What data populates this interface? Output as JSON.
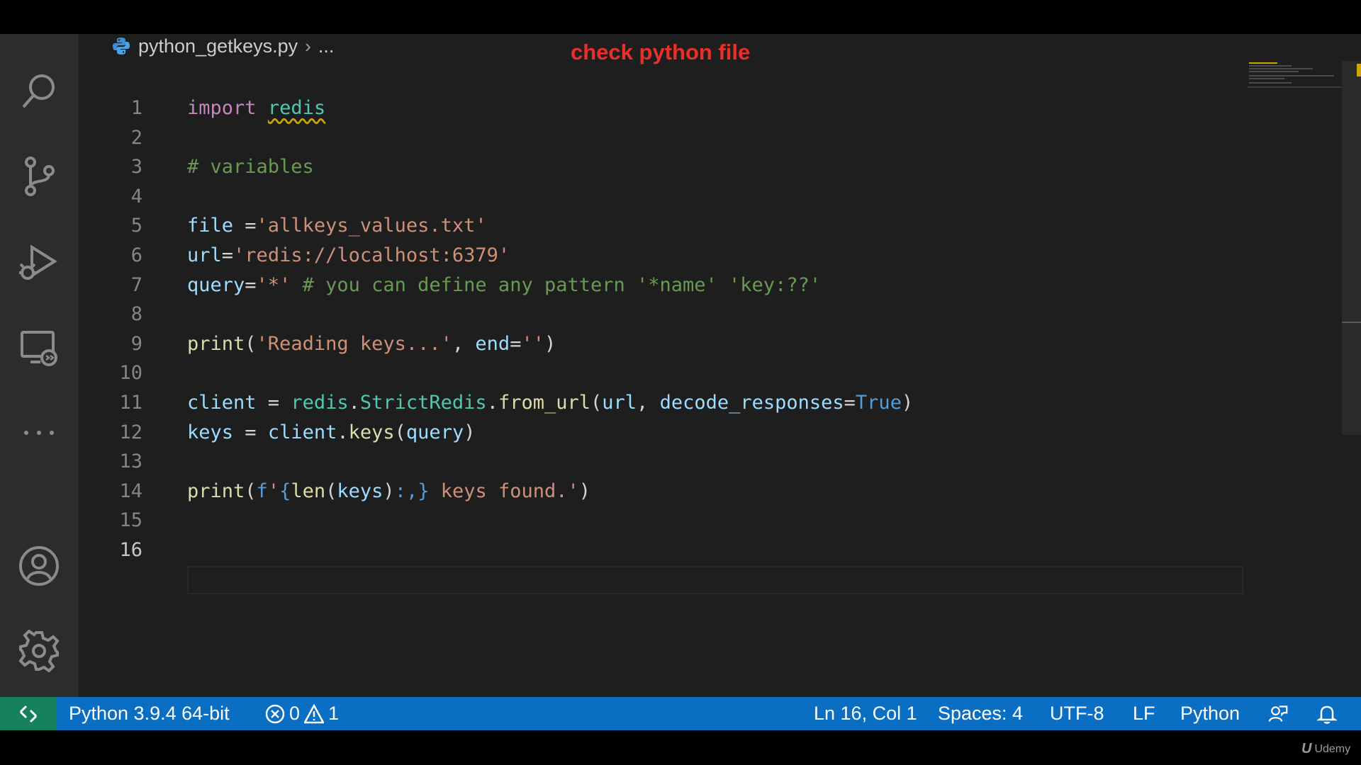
{
  "editor": {
    "breadcrumb": {
      "file": "python_getkeys.py",
      "more": "..."
    },
    "annotation": "check python file",
    "lines": [
      {
        "n": "1",
        "tokens": [
          [
            "kw",
            "import"
          ],
          [
            "op",
            " "
          ],
          [
            "mod squig",
            "redis"
          ]
        ]
      },
      {
        "n": "2",
        "tokens": []
      },
      {
        "n": "3",
        "tokens": [
          [
            "cm",
            "# variables"
          ]
        ]
      },
      {
        "n": "4",
        "tokens": []
      },
      {
        "n": "5",
        "tokens": [
          [
            "var",
            "file"
          ],
          [
            "op",
            " ="
          ],
          [
            "str",
            "'allkeys_values.txt'"
          ]
        ]
      },
      {
        "n": "6",
        "tokens": [
          [
            "var",
            "url"
          ],
          [
            "op",
            "="
          ],
          [
            "str",
            "'redis://localhost:6379'"
          ]
        ]
      },
      {
        "n": "7",
        "tokens": [
          [
            "var",
            "query"
          ],
          [
            "op",
            "="
          ],
          [
            "str",
            "'*'"
          ],
          [
            "op",
            " "
          ],
          [
            "cm",
            "# you can define any pattern '*name' 'key:??'"
          ]
        ]
      },
      {
        "n": "8",
        "tokens": []
      },
      {
        "n": "9",
        "tokens": [
          [
            "fn",
            "print"
          ],
          [
            "op",
            "("
          ],
          [
            "str",
            "'Reading keys...'"
          ],
          [
            "op",
            ", "
          ],
          [
            "var",
            "end"
          ],
          [
            "op",
            "="
          ],
          [
            "str",
            "''"
          ],
          [
            "op",
            ")"
          ]
        ]
      },
      {
        "n": "10",
        "tokens": []
      },
      {
        "n": "11",
        "tokens": [
          [
            "var",
            "client"
          ],
          [
            "op",
            " = "
          ],
          [
            "cls",
            "redis"
          ],
          [
            "op",
            "."
          ],
          [
            "cls",
            "StrictRedis"
          ],
          [
            "op",
            "."
          ],
          [
            "fn",
            "from_url"
          ],
          [
            "op",
            "("
          ],
          [
            "var",
            "url"
          ],
          [
            "op",
            ", "
          ],
          [
            "var",
            "decode_responses"
          ],
          [
            "op",
            "="
          ],
          [
            "bl",
            "True"
          ],
          [
            "op",
            ")"
          ]
        ]
      },
      {
        "n": "12",
        "tokens": [
          [
            "var",
            "keys"
          ],
          [
            "op",
            " = "
          ],
          [
            "var",
            "client"
          ],
          [
            "op",
            "."
          ],
          [
            "fn",
            "keys"
          ],
          [
            "op",
            "("
          ],
          [
            "var",
            "query"
          ],
          [
            "op",
            ")"
          ]
        ]
      },
      {
        "n": "13",
        "tokens": []
      },
      {
        "n": "14",
        "tokens": [
          [
            "fn",
            "print"
          ],
          [
            "op",
            "("
          ],
          [
            "bl",
            "f"
          ],
          [
            "str",
            "'"
          ],
          [
            "bl",
            "{"
          ],
          [
            "fn",
            "len"
          ],
          [
            "op",
            "("
          ],
          [
            "var",
            "keys"
          ],
          [
            "op",
            ")"
          ],
          [
            "bl",
            ":,}"
          ],
          [
            "str",
            " keys found.'"
          ],
          [
            "op",
            ")"
          ]
        ]
      },
      {
        "n": "15",
        "tokens": []
      },
      {
        "n": "16",
        "tokens": [],
        "active": true
      }
    ]
  },
  "activity_icons": [
    "search-icon",
    "source-control-icon",
    "run-debug-icon",
    "remote-explorer-icon",
    "more-icon",
    "account-icon",
    "gear-icon"
  ],
  "status": {
    "interpreter": "Python 3.9.4 64-bit",
    "errors": "0",
    "warnings": "1",
    "cursor": "Ln 16, Col 1",
    "spaces": "Spaces: 4",
    "encoding": "UTF-8",
    "eol": "LF",
    "language": "Python"
  },
  "watermark": {
    "logo": "U",
    "text": "Udemy"
  },
  "colors": {
    "status_bar": "#0a6fc2",
    "remote_indicator": "#16825d",
    "annotation": "#e8302a",
    "editor_bg": "#1e1e1e"
  }
}
